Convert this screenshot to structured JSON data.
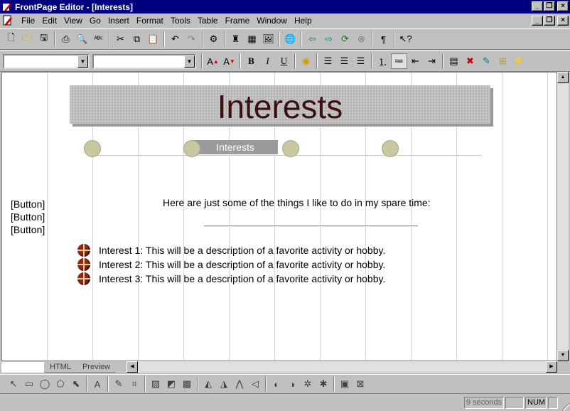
{
  "window": {
    "title": "FrontPage Editor - [Interests]"
  },
  "menubar": {
    "items": [
      {
        "label": "File"
      },
      {
        "label": "Edit"
      },
      {
        "label": "View"
      },
      {
        "label": "Go"
      },
      {
        "label": "Insert"
      },
      {
        "label": "Format"
      },
      {
        "label": "Tools"
      },
      {
        "label": "Table"
      },
      {
        "label": "Frame"
      },
      {
        "label": "Window"
      },
      {
        "label": "Help"
      }
    ]
  },
  "toolbar_format": {
    "style_value": "",
    "font_value": ""
  },
  "page": {
    "banner_title": "Interests",
    "nav_current": "Interests",
    "left_buttons": [
      "[Button]",
      "[Button]",
      "[Button]"
    ],
    "intro": "Here are just some of the things I like to do in my spare time:",
    "interests": [
      "Interest 1: This will be a description of a favorite activity or hobby.",
      "Interest 2: This will be a description of a favorite activity or hobby.",
      "Interest 3: This will be a description of a favorite activity or hobby."
    ]
  },
  "view_tabs": [
    {
      "label": ""
    },
    {
      "label": "HTML"
    },
    {
      "label": "Preview"
    }
  ],
  "status": {
    "time": "9 seconds",
    "num": "NUM"
  },
  "colors": {
    "titlebar": "#000080",
    "banner_text": "#3a1010",
    "bullet": "#8b2c10"
  }
}
